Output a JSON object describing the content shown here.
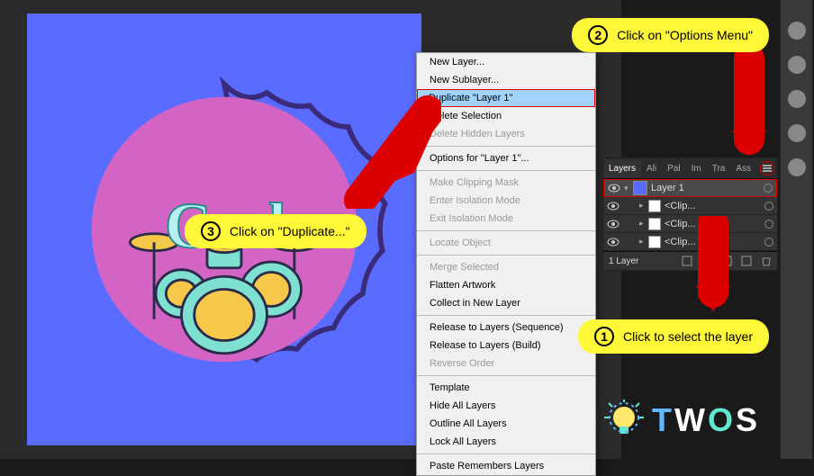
{
  "canvas": {
    "artwork_text": "Cool"
  },
  "context_menu": {
    "items": [
      {
        "label": "New Layer...",
        "state": "normal"
      },
      {
        "label": "New Sublayer...",
        "state": "normal"
      },
      {
        "label": "Duplicate \"Layer 1\"",
        "state": "highlighted"
      },
      {
        "label": "Delete Selection",
        "state": "normal"
      },
      {
        "label": "Delete Hidden Layers",
        "state": "disabled"
      },
      {
        "sep": true
      },
      {
        "label": "Options for \"Layer 1\"...",
        "state": "normal"
      },
      {
        "sep": true
      },
      {
        "label": "Make Clipping Mask",
        "state": "disabled"
      },
      {
        "label": "Enter Isolation Mode",
        "state": "disabled"
      },
      {
        "label": "Exit Isolation Mode",
        "state": "disabled"
      },
      {
        "sep": true
      },
      {
        "label": "Locate Object",
        "state": "disabled"
      },
      {
        "sep": true
      },
      {
        "label": "Merge Selected",
        "state": "disabled"
      },
      {
        "label": "Flatten Artwork",
        "state": "normal"
      },
      {
        "label": "Collect in New Layer",
        "state": "normal"
      },
      {
        "sep": true
      },
      {
        "label": "Release to Layers (Sequence)",
        "state": "normal"
      },
      {
        "label": "Release to Layers (Build)",
        "state": "normal"
      },
      {
        "label": "Reverse Order",
        "state": "disabled"
      },
      {
        "sep": true
      },
      {
        "label": "Template",
        "state": "normal"
      },
      {
        "label": "Hide All Layers",
        "state": "normal"
      },
      {
        "label": "Outline All Layers",
        "state": "normal"
      },
      {
        "label": "Lock All Layers",
        "state": "normal"
      },
      {
        "sep": true
      },
      {
        "label": "Paste Remembers Layers",
        "state": "normal"
      }
    ]
  },
  "layers_panel": {
    "tabs": [
      "Layers",
      "Ali",
      "Pal",
      "Im",
      "Tra",
      "Ass"
    ],
    "active_tab": "Layers",
    "rows": [
      {
        "name": "Layer 1",
        "selected": true,
        "expanded": true,
        "depth": 0,
        "thumb_class": ""
      },
      {
        "name": "<Clip...",
        "selected": false,
        "expanded": false,
        "depth": 1,
        "thumb_class": "sub"
      },
      {
        "name": "<Clip...",
        "selected": false,
        "expanded": false,
        "depth": 1,
        "thumb_class": "sub"
      },
      {
        "name": "<Clip...",
        "selected": false,
        "expanded": false,
        "depth": 1,
        "thumb_class": "sub"
      }
    ],
    "footer_text": "1 Layer"
  },
  "callouts": {
    "c1_num": "1",
    "c1_text": "Click to select the layer",
    "c2_num": "2",
    "c2_text": "Click on \"Options Menu\"",
    "c3_num": "3",
    "c3_text": "Click on \"Duplicate...\""
  },
  "logo": {
    "text": "TWOS"
  }
}
